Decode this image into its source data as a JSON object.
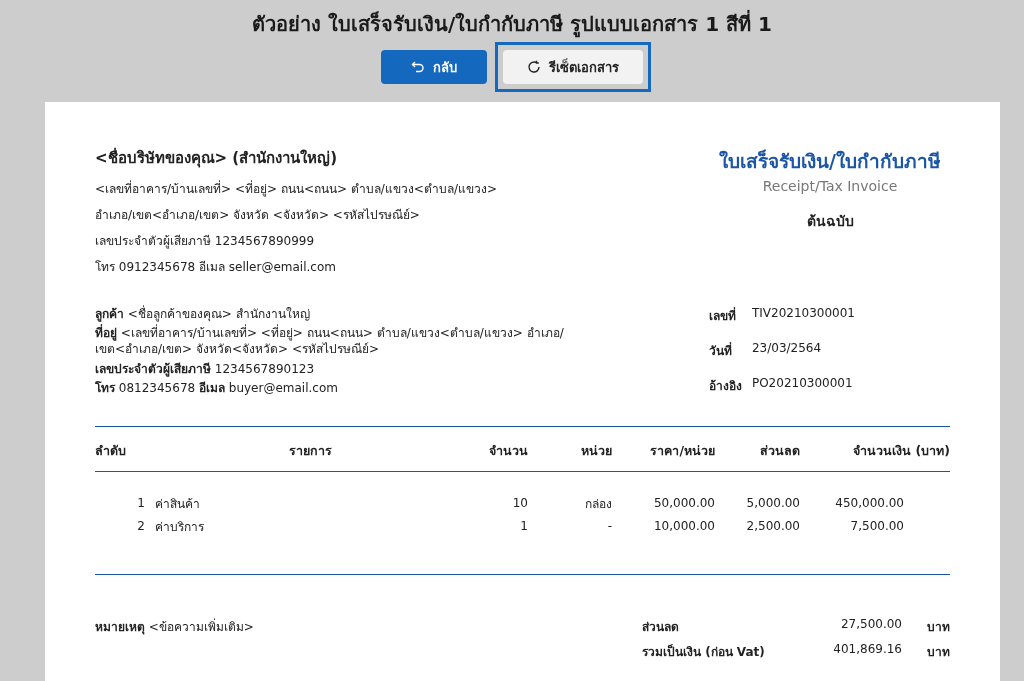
{
  "page_title": "ตัวอย่าง ใบเสร็จรับเงิน/ใบกำกับภาษี รูปแบบเอกสาร 1 สีที่ 1",
  "buttons": [
    {
      "label": "กลับ",
      "kind": "primary",
      "focused": false
    },
    {
      "label": "รีเซ็ตเอกสาร",
      "kind": "secondary",
      "focused": true
    }
  ],
  "seller": {
    "name": "<ชื่อบริษัทของคุณ> (สำนักงานใหญ่)",
    "lines": [
      "<เลขที่อาคาร/บ้านเลขที่> <ที่อยู่> ถนน<ถนน> ตำบล/แขวง<ตำบล/แขวง>",
      "อำเภอ/เขต<อำเภอ/เขต> จังหวัด <จังหวัด> <รหัสไปรษณีย์>",
      "เลขประจำตัวผู้เสียภาษี 1234567890999",
      "โทร 0912345678  อีเมล seller@email.com"
    ]
  },
  "document": {
    "title": "ใบเสร็จรับเงิน/ใบกำกับภาษี",
    "subtitle": "Receipt/Tax Invoice",
    "copy": "ต้นฉบับ"
  },
  "customer": [
    "**ลูกค้า** <ชื่อลูกค้าของคุณ> สำนักงานใหญ่",
    "**ที่อยู่** <เลขที่อาคาร/บ้านเลขที่> <ที่อยู่> ถนน<ถนน> ตำบล/แขวง<ตำบล/แขวง> อำเภอ/เขต<อำเภอ/เขต> จังหวัด<จังหวัด> <รหัสไปรษณีย์>",
    "**เลขประจำตัวผู้เสียภาษี** 1234567890123",
    "**โทร** 0812345678  **อีเมล** buyer@email.com"
  ],
  "meta": [
    {
      "label": "เลขที่",
      "value": "TIV20210300001"
    },
    {
      "label": "วันที่",
      "value": "23/03/2564"
    },
    {
      "label": "อ้างอิง",
      "value": "PO20210300001"
    }
  ],
  "table": {
    "columns": [
      "ลำดับ",
      "รายการ",
      "จำนวน",
      "หน่วย",
      "ราคา/หน่วย",
      "ส่วนลด",
      "จำนวนเงิน (บาท)"
    ],
    "rows": [
      [
        "1",
        "ค่าสินค้า",
        "10",
        "กล่อง",
        "50,000.00",
        "5,000.00",
        "450,000.00"
      ],
      [
        "2",
        "ค่าบริการ",
        "1",
        "-",
        "10,000.00",
        "2,500.00",
        "7,500.00"
      ]
    ]
  },
  "remark": "**หมายเหตุ** <ข้อความเพิ่มเติม>",
  "totals": [
    {
      "label": "ส่วนลด",
      "value": "27,500.00",
      "unit": "บาท"
    },
    {
      "label": "รวมเป็นเงิน (ก่อน Vat)",
      "value": "401,869.16",
      "unit": "บาท"
    }
  ]
}
